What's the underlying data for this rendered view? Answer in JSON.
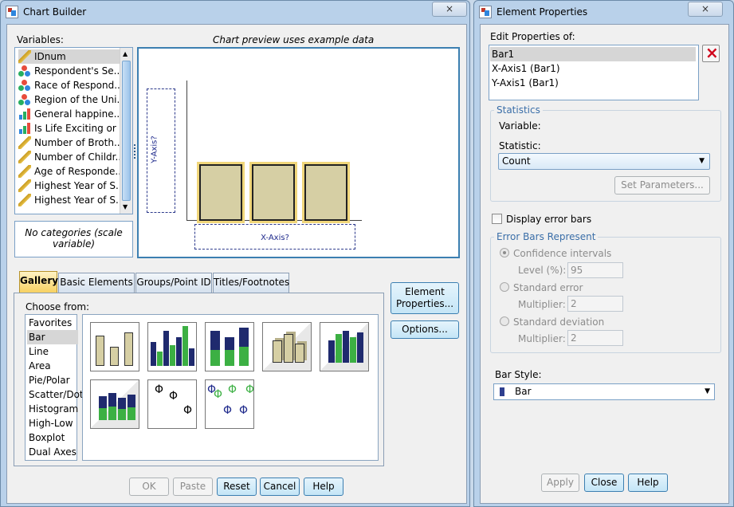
{
  "chart_builder": {
    "title": "Chart Builder",
    "close_icon": "×",
    "variables_label": "Variables:",
    "preview_note": "Chart preview uses example data",
    "variables": [
      {
        "label": "IDnum",
        "icon": "scale-icon"
      },
      {
        "label": "Respondent's Se...",
        "icon": "nominal-icon"
      },
      {
        "label": "Race of Respond...",
        "icon": "nominal-icon"
      },
      {
        "label": "Region of the Uni...",
        "icon": "nominal-icon"
      },
      {
        "label": "General happine...",
        "icon": "ordinal-icon"
      },
      {
        "label": "Is Life Exciting or ...",
        "icon": "ordinal-icon"
      },
      {
        "label": "Number of Broth...",
        "icon": "scale-icon"
      },
      {
        "label": "Number of Childr...",
        "icon": "scale-icon"
      },
      {
        "label": "Age of Responde...",
        "icon": "scale-icon"
      },
      {
        "label": "Highest Year of S...",
        "icon": "scale-icon"
      },
      {
        "label": "Highest Year of S...",
        "icon": "scale-icon"
      }
    ],
    "categories_note": "No categories (scale variable)",
    "y_axis_drop": "Y-Axis?",
    "x_axis_drop": "X-Axis?",
    "tabs": [
      "Gallery",
      "Basic Elements",
      "Groups/Point ID",
      "Titles/Footnotes"
    ],
    "choose_from_label": "Choose from:",
    "chart_types": [
      "Favorites",
      "Bar",
      "Line",
      "Area",
      "Pie/Polar",
      "Scatter/Dot",
      "Histogram",
      "High-Low",
      "Boxplot",
      "Dual Axes"
    ],
    "element_properties_btn": "Element Properties...",
    "options_btn": "Options...",
    "buttons": {
      "ok": "OK",
      "paste": "Paste",
      "reset": "Reset",
      "cancel": "Cancel",
      "help": "Help"
    }
  },
  "element_properties": {
    "title": "Element Properties",
    "close_icon": "×",
    "edit_label": "Edit Properties of:",
    "elements": [
      "Bar1",
      "X-Axis1 (Bar1)",
      "Y-Axis1 (Bar1)"
    ],
    "delete_icon": "×",
    "statistics_label": "Statistics",
    "variable_label": "Variable:",
    "statistic_label": "Statistic:",
    "statistic_value": "Count",
    "set_params_btn": "Set Parameters...",
    "display_error_bars": "Display error bars",
    "error_bars_label": "Error Bars Represent",
    "ci_label": "Confidence intervals",
    "level_label": "Level (%):",
    "level_value": "95",
    "se_label": "Standard error",
    "se_mult_label": "Multiplier:",
    "se_mult_value": "2",
    "sd_label": "Standard deviation",
    "sd_mult_label": "Multiplier:",
    "sd_mult_value": "2",
    "bar_style_label": "Bar Style:",
    "bar_style_value": "Bar",
    "buttons": {
      "apply": "Apply",
      "close": "Close",
      "help": "Help"
    }
  },
  "colors": {
    "bar_fill": "#d6cfa4",
    "bar_border": "#f0d67a",
    "thumb_navy": "#1f2a6e",
    "thumb_green": "#3cb043",
    "accent_blue": "#2e5c8a"
  }
}
